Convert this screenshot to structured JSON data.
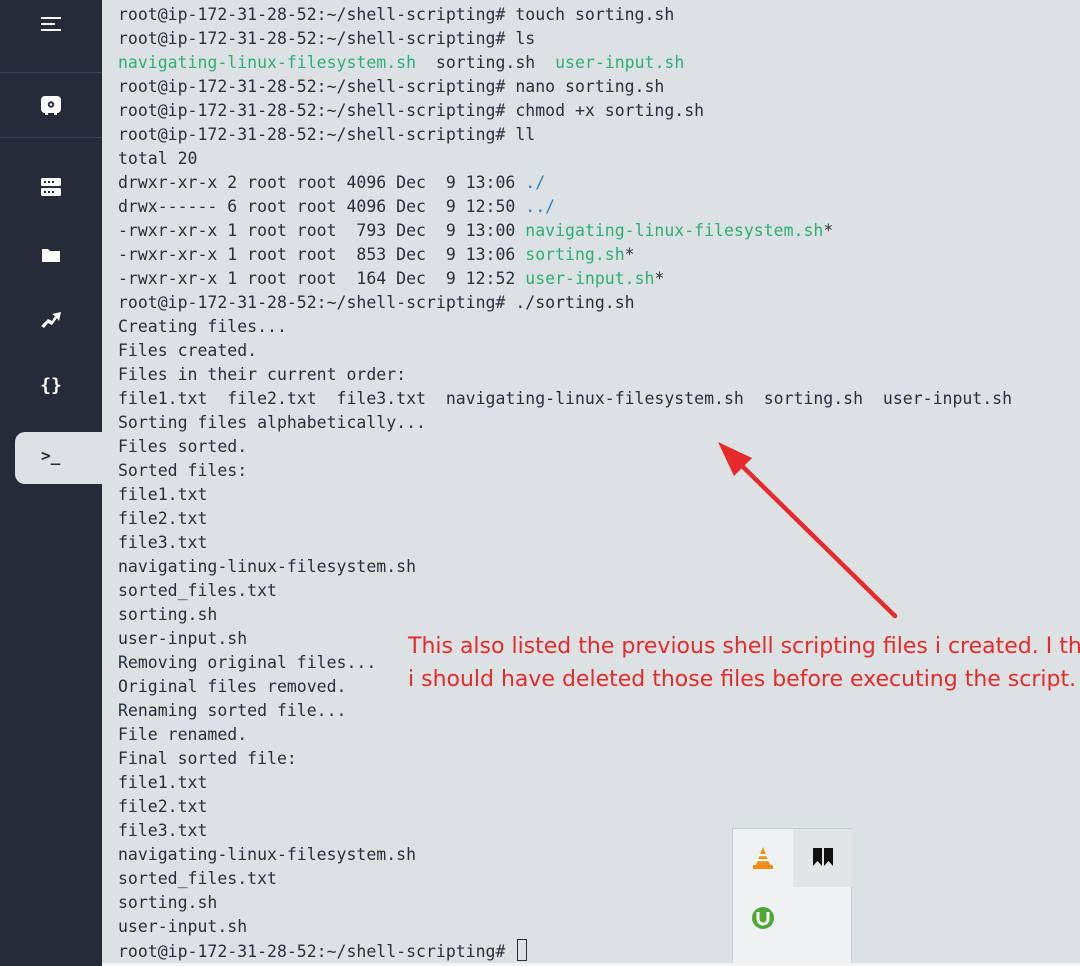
{
  "sidebar": {
    "items": [
      {
        "icon": "hamburger-menu-icon"
      },
      {
        "icon": "lab-settings-icon"
      },
      {
        "icon": "server-icon"
      },
      {
        "icon": "folder-icon"
      },
      {
        "icon": "share-arrow-icon"
      },
      {
        "icon": "code-braces-icon",
        "glyph": "{}"
      },
      {
        "icon": "terminal-icon",
        "glyph": ">_",
        "active": true
      }
    ]
  },
  "terminal": {
    "prompt": "root@ip-172-31-28-52:~/shell-scripting#",
    "lines": [
      {
        "cmd": " touch sorting.sh"
      },
      {
        "cmd": " ls"
      },
      {
        "ls": [
          "navigating-linux-filesystem.sh",
          "sorting.sh",
          "user-input.sh"
        ]
      },
      {
        "cmd": " nano sorting.sh"
      },
      {
        "cmd": " chmod +x sorting.sh"
      },
      {
        "cmd": " ll"
      },
      {
        "text": "total 20"
      },
      {
        "perm": "drwxr-xr-x 2 root root 4096 Dec  9 13:06 ",
        "name": "./",
        "kind": "dir"
      },
      {
        "perm": "drwx------ 6 root root 4096 Dec  9 12:50 ",
        "name": "../",
        "kind": "dir"
      },
      {
        "perm": "-rwxr-xr-x 1 root root  793 Dec  9 13:00 ",
        "name": "navigating-linux-filesystem.sh",
        "kind": "exec",
        "suffix": "*"
      },
      {
        "perm": "-rwxr-xr-x 1 root root  853 Dec  9 13:06 ",
        "name": "sorting.sh",
        "kind": "exec",
        "suffix": "*"
      },
      {
        "perm": "-rwxr-xr-x 1 root root  164 Dec  9 12:52 ",
        "name": "user-input.sh",
        "kind": "exec",
        "suffix": "*"
      },
      {
        "cmd": " ./sorting.sh"
      },
      {
        "text": "Creating files..."
      },
      {
        "text": "Files created."
      },
      {
        "text": "Files in their current order:"
      },
      {
        "text": "file1.txt  file2.txt  file3.txt  navigating-linux-filesystem.sh  sorting.sh  user-input.sh"
      },
      {
        "text": "Sorting files alphabetically..."
      },
      {
        "text": "Files sorted."
      },
      {
        "text": "Sorted files:"
      },
      {
        "text": "file1.txt"
      },
      {
        "text": "file2.txt"
      },
      {
        "text": "file3.txt"
      },
      {
        "text": "navigating-linux-filesystem.sh"
      },
      {
        "text": "sorted_files.txt"
      },
      {
        "text": "sorting.sh"
      },
      {
        "text": "user-input.sh"
      },
      {
        "text": "Removing original files..."
      },
      {
        "text": "Original files removed."
      },
      {
        "text": "Renaming sorted file..."
      },
      {
        "text": "File renamed."
      },
      {
        "text": "Final sorted file:"
      },
      {
        "text": "file1.txt"
      },
      {
        "text": "file2.txt"
      },
      {
        "text": "file3.txt"
      },
      {
        "text": "navigating-linux-filesystem.sh"
      },
      {
        "text": "sorted_files.txt"
      },
      {
        "text": "sorting.sh"
      },
      {
        "text": "user-input.sh"
      },
      {
        "cmd": " ",
        "cursor": true
      }
    ]
  },
  "annotation": {
    "line1": "This also listed the previous shell scripting files i created. I think",
    "line2": "i should have deleted those files before executing the script.",
    "color": "#e62a2a"
  },
  "tray": {
    "icons": [
      "vlc-cone-icon",
      "bookmark-app-icon",
      "utorrent-icon"
    ]
  },
  "colors": {
    "sidebar": "#262b3a",
    "terminal_bg": "#dce1e4",
    "exec_green": "#2fae77",
    "dir_blue": "#2b7fc4"
  }
}
